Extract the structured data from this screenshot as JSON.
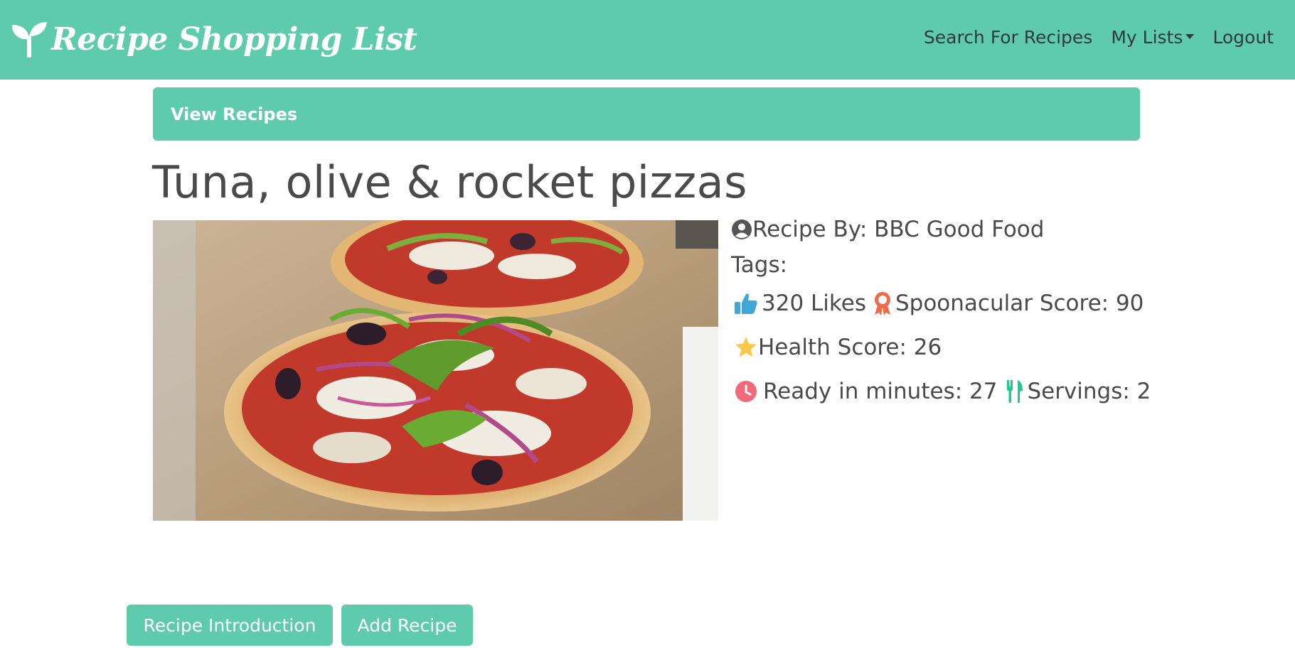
{
  "app": {
    "brand": "Recipe Shopping List",
    "accent_color": "#5ecbad",
    "brand_icon": "sprout-icon"
  },
  "nav": {
    "search": "Search For Recipes",
    "my_lists": "My Lists",
    "logout": "Logout"
  },
  "view_bar": {
    "label": "View Recipes"
  },
  "recipe": {
    "title": "Tuna, olive & rocket pizzas",
    "image_alt": "Tuna, olive & rocket pizzas",
    "recipe_by_label": "Recipe By: BBC Good Food",
    "tags_label": "Tags:",
    "likes_label": "320 Likes",
    "spoonacular_label": "Spoonacular Score: 90",
    "health_label": "Health Score: 26",
    "ready_label": "Ready in minutes: 27",
    "servings_label": "Servings: 2"
  },
  "icons": {
    "author": "user-circle-icon",
    "likes": "thumbs-up-icon",
    "score": "award-ribbon-icon",
    "health": "star-icon",
    "time": "clock-icon",
    "servings": "utensils-icon"
  },
  "colors": {
    "likes_icon": "#3fa8d8",
    "score_icon": "#ef6a4a",
    "health_icon": "#f7c948",
    "time_icon": "#f06a7a",
    "servings_icon": "#22c98e"
  },
  "actions": {
    "intro_button": "Recipe Introduction",
    "add_button": "Add Recipe"
  }
}
